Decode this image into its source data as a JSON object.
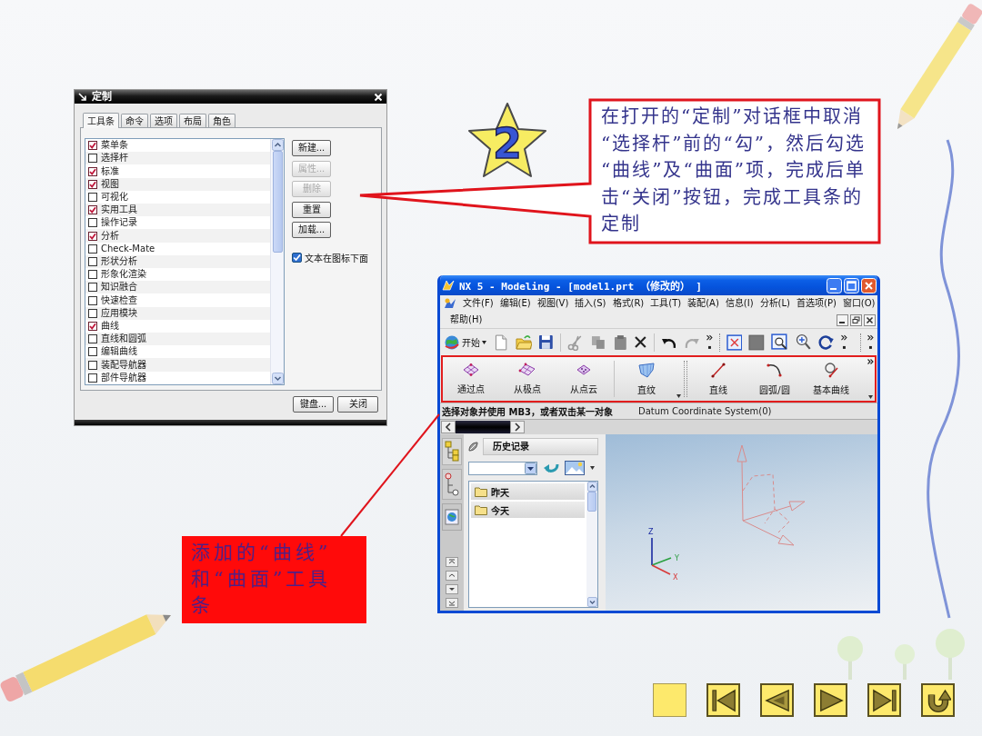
{
  "dialog": {
    "title": "定制",
    "tabs": [
      {
        "label": "工具条",
        "selected": true
      },
      {
        "label": "命令",
        "selected": false
      },
      {
        "label": "选项",
        "selected": false
      },
      {
        "label": "布局",
        "selected": false
      },
      {
        "label": "角色",
        "selected": false
      }
    ],
    "toolbars": [
      {
        "label": "菜单条",
        "checked": true
      },
      {
        "label": "选择杆",
        "checked": false
      },
      {
        "label": "标准",
        "checked": true
      },
      {
        "label": "视图",
        "checked": true
      },
      {
        "label": "可视化",
        "checked": false
      },
      {
        "label": "实用工具",
        "checked": true
      },
      {
        "label": "操作记录",
        "checked": false
      },
      {
        "label": "分析",
        "checked": true
      },
      {
        "label": "Check-Mate",
        "checked": false
      },
      {
        "label": "形状分析",
        "checked": false
      },
      {
        "label": "形象化渲染",
        "checked": false
      },
      {
        "label": "知识融合",
        "checked": false
      },
      {
        "label": "快速检查",
        "checked": false
      },
      {
        "label": "应用模块",
        "checked": false
      },
      {
        "label": "曲线",
        "checked": true
      },
      {
        "label": "直线和圆弧",
        "checked": false
      },
      {
        "label": "编辑曲线",
        "checked": false
      },
      {
        "label": "装配导航器",
        "checked": false
      },
      {
        "label": "部件导航器",
        "checked": false
      }
    ],
    "actions": [
      {
        "label": "新建...",
        "disabled": false
      },
      {
        "label": "属性...",
        "disabled": true
      },
      {
        "label": "删除",
        "disabled": true
      },
      {
        "label": "重置",
        "disabled": false
      },
      {
        "label": "加载...",
        "disabled": false
      }
    ],
    "option": {
      "label": "文本在图标下面",
      "checked": true
    },
    "buttons": [
      "键盘...",
      "关闭"
    ]
  },
  "step": {
    "number": "2"
  },
  "callout": {
    "text": "在打开的“定制”对话框中取消“选择杆”前的“勾”，然后勾选“曲线”及“曲面”项，完成后单击“关闭”按钮，完成工具条的定制"
  },
  "nx_window": {
    "title": "NX 5 - Modeling - [model1.prt （修改的） ]",
    "menus": [
      "文件(F)",
      "编辑(E)",
      "视图(V)",
      "插入(S)",
      "格式(R)",
      "工具(T)",
      "装配(A)",
      "信息(I)",
      "分析(L)",
      "首选项(P)",
      "窗口(O)",
      "帮助(H)"
    ],
    "start_label": "开始",
    "curve_toolbar": [
      {
        "label": "通过点",
        "kind": "through-points"
      },
      {
        "label": "从极点",
        "kind": "from-poles"
      },
      {
        "label": "从点云",
        "kind": "from-cloud"
      },
      {
        "label": "直纹",
        "kind": "ruled"
      },
      {
        "label": "直线",
        "kind": "line"
      },
      {
        "label": "圆弧/圆",
        "kind": "arc"
      },
      {
        "label": "基本曲线",
        "kind": "basic-curves"
      }
    ],
    "status": {
      "prompt": "选择对象并使用 MB3，或者双击某一对象",
      "selection": "Datum Coordinate System(0)"
    },
    "navigator": {
      "title": "历史记录",
      "folders": [
        "昨天",
        "今天"
      ]
    },
    "triad_labels": [
      "Z",
      "Y",
      "X"
    ]
  },
  "annotation": {
    "text": "添加的“曲线”和“曲面”工具条"
  },
  "nav_buttons": [
    {
      "kind": "blank"
    },
    {
      "kind": "first"
    },
    {
      "kind": "previous"
    },
    {
      "kind": "next"
    },
    {
      "kind": "last"
    },
    {
      "kind": "return"
    }
  ]
}
